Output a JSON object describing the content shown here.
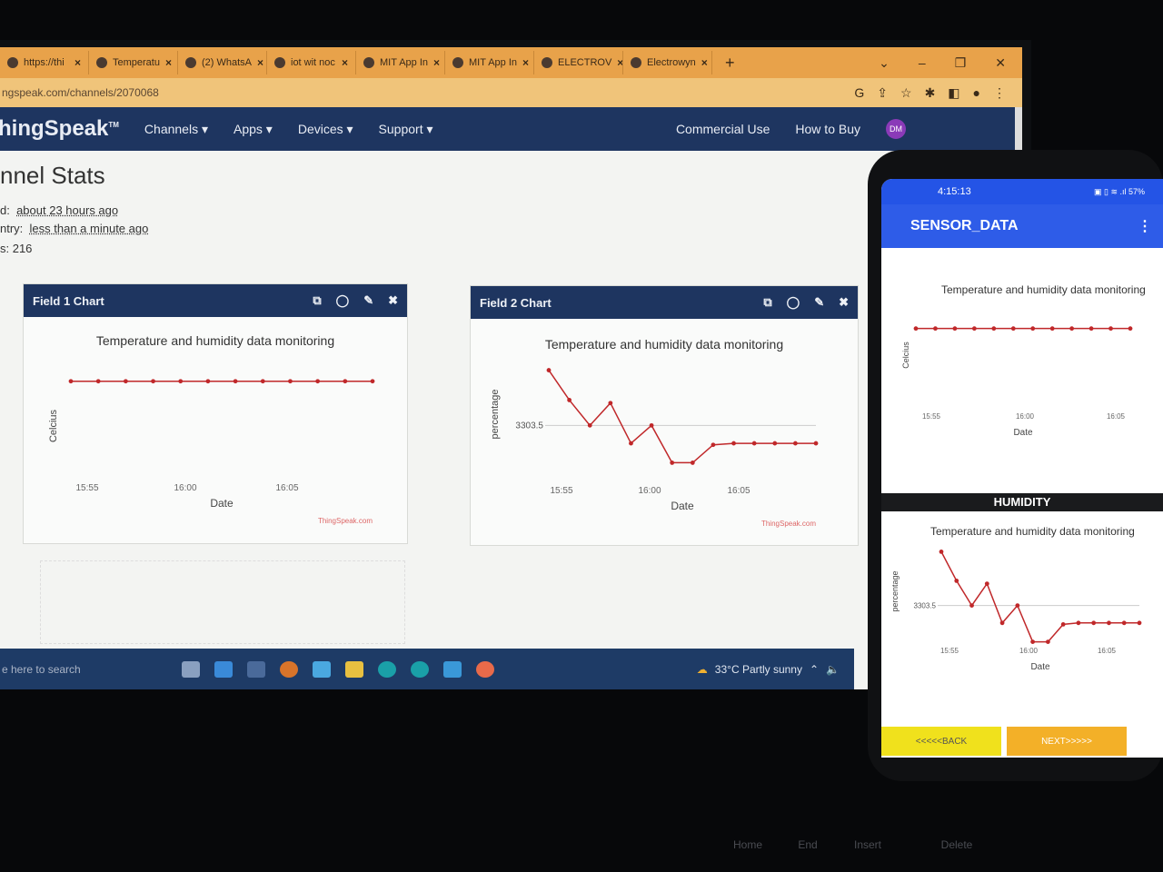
{
  "browser": {
    "tabs": [
      {
        "label": "https://thi"
      },
      {
        "label": "Temperatu"
      },
      {
        "label": "(2) WhatsA"
      },
      {
        "label": "iot wit noc"
      },
      {
        "label": "MIT App In"
      },
      {
        "label": "MIT App In"
      },
      {
        "label": "ELECTROV"
      },
      {
        "label": "Electrowyn"
      }
    ],
    "new_tab": "+",
    "url": "ngspeak.com/channels/2070068"
  },
  "nav": {
    "logo": "hingSpeak",
    "tm": "TM",
    "items": [
      "Channels ▾",
      "Apps ▾",
      "Devices ▾",
      "Support ▾"
    ],
    "commercial": "Commercial Use",
    "how_to_buy": "How to Buy",
    "avatar": "DM"
  },
  "stats": {
    "title": "nnel Stats",
    "created_label": "d:",
    "created_value": "about 23 hours ago",
    "last_label": "ntry:",
    "last_value": "less than a minute ago",
    "entries": "s: 216"
  },
  "field1": {
    "header": "Field 1 Chart",
    "chart_title": "Temperature and humidity data monitoring",
    "ylabel": "Celcius",
    "xlabel": "Date",
    "credit": "ThingSpeak.com",
    "x_ticks": [
      "15:55",
      "16:00",
      "16:05"
    ]
  },
  "field2": {
    "header": "Field 2 Chart",
    "chart_title": "Temperature and humidity data monitoring",
    "ylabel": "percentage",
    "xlabel": "Date",
    "credit": "ThingSpeak.com",
    "y_tick": "3303.5",
    "x_ticks": [
      "15:55",
      "16:00",
      "16:05"
    ]
  },
  "taskbar": {
    "search": "e here to search",
    "weather": "33°C  Partly sunny"
  },
  "phone": {
    "time": "4:15:13",
    "indicators": "▣ ▯ ≋ .ıl 57%",
    "title": "SENSOR_DATA",
    "menu": "⋮",
    "chart1_title": "Temperature and humidity data monitoring",
    "chart1_ylabel": "Celcius",
    "chart1_xlabel": "Date",
    "chart1_ticks": [
      "15:55",
      "16:00",
      "16:05"
    ],
    "section": "HUMIDITY",
    "chart2_title": "Temperature and humidity data monitoring",
    "chart2_ylabel": "percentage",
    "chart2_xlabel": "Date",
    "chart2_ytick": "3303.5",
    "chart2_ticks": [
      "15:55",
      "16:00",
      "16:05"
    ],
    "back": "<<<<<BACK",
    "next": "NEXT>>>>>"
  },
  "keyboard": [
    "Home",
    "End",
    "Insert",
    "Delete"
  ],
  "colors": {
    "series": "#c0282a",
    "nav": "#1e3560",
    "tabbar": "#e8a24a"
  },
  "chart_data": [
    {
      "type": "line",
      "title": "Temperature and humidity data monitoring",
      "xlabel": "Date",
      "ylabel": "Celcius",
      "x": [
        "15:54",
        "15:55",
        "15:56",
        "15:57",
        "15:59",
        "16:00",
        "16:01",
        "16:01.5",
        "16:03",
        "16:04",
        "16:05",
        "16:08"
      ],
      "series": [
        {
          "values": [
            0,
            0,
            0,
            0,
            0,
            0,
            0,
            0,
            0,
            0,
            0,
            0
          ]
        }
      ]
    },
    {
      "type": "line",
      "title": "Temperature and humidity data monitoring",
      "xlabel": "Date",
      "ylabel": "percentage",
      "yticks": [
        3303.5
      ],
      "x": [
        "15:54",
        "15:55",
        "15:56",
        "15:57",
        "15:58",
        "15:59",
        "16:00",
        "16:00.5",
        "16:01",
        "16:02",
        "16:03",
        "16:04",
        "16:06",
        "16:09"
      ],
      "series": [
        {
          "values": [
            3307.2,
            3305.2,
            3303.5,
            3305.0,
            3302.3,
            3303.5,
            3301.0,
            3301.0,
            3302.2,
            3302.3,
            3302.3,
            3302.3,
            3302.3,
            3302.3
          ]
        }
      ]
    }
  ]
}
